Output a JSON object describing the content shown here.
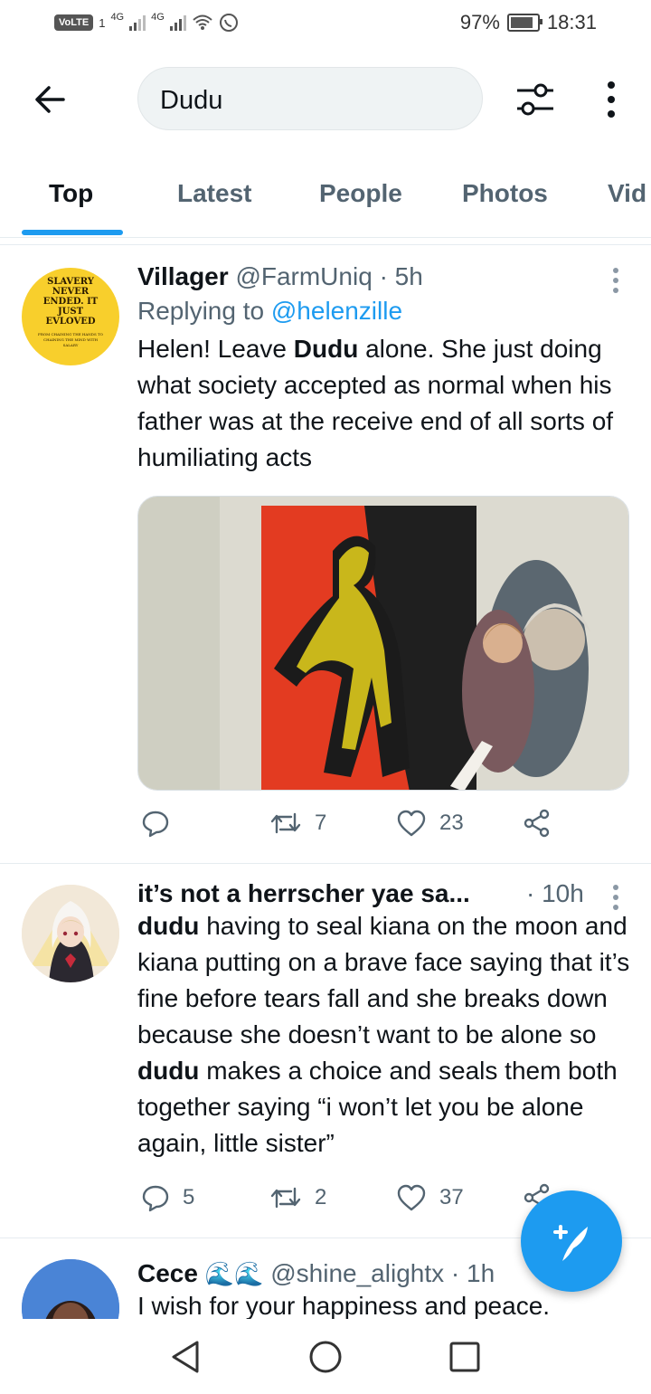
{
  "status_bar": {
    "volte": "VoLTE",
    "sim1": "1",
    "net1": "4G",
    "net2": "4G",
    "battery": "97%",
    "time": "18:31"
  },
  "search": {
    "query": "Dudu"
  },
  "tabs": [
    {
      "label": "Top",
      "active": true
    },
    {
      "label": "Latest"
    },
    {
      "label": "People"
    },
    {
      "label": "Photos"
    },
    {
      "label": "Vid"
    }
  ],
  "tweets": [
    {
      "name": "Villager",
      "handle": "@FarmUniq",
      "time": "5h",
      "replying_prefix": "Replying to",
      "replying_to": "@helenzille",
      "text_parts": [
        "Helen! Leave ",
        "Dudu",
        " alone. She just doing what society accepted as normal when his father was at the receive end of all sorts of humiliating acts"
      ],
      "avatar_text": [
        "SLAVERY",
        "NEVER",
        "ENDED. IT",
        "JUST",
        "EVLOVED"
      ],
      "avatar_small": [
        "FROM CHAINING THE HANDS TO",
        "CHAINING THE MIND WITH",
        "SALARY"
      ],
      "replies": "",
      "retweets": "7",
      "likes": "23"
    },
    {
      "name": "it’s not a herrscher yae sa...",
      "time": "10h",
      "text_parts": [
        "dudu",
        " having to seal kiana on the moon and kiana putting on a brave face saying that it’s fine before tears fall and she breaks down because she doesn’t want to be alone so ",
        "dudu",
        " makes a choice and seals them both together saying “i won’t let you be alone again, little sister”"
      ],
      "replies": "5",
      "retweets": "2",
      "likes": "37"
    },
    {
      "name": "Cece",
      "emoji": "🌊🌊",
      "handle": "@shine_alightx",
      "time": "1h",
      "text": "I wish for your happiness and peace."
    }
  ],
  "colors": {
    "accent": "#1d9bf0",
    "secondary_text": "#536471",
    "divider": "#e6ecf0"
  },
  "icons": [
    "back-arrow-icon",
    "filter-icon",
    "more-vertical-icon",
    "reply-icon",
    "retweet-icon",
    "like-icon",
    "share-icon",
    "compose-icon",
    "nav-back-icon",
    "nav-home-icon",
    "nav-recents-icon"
  ]
}
